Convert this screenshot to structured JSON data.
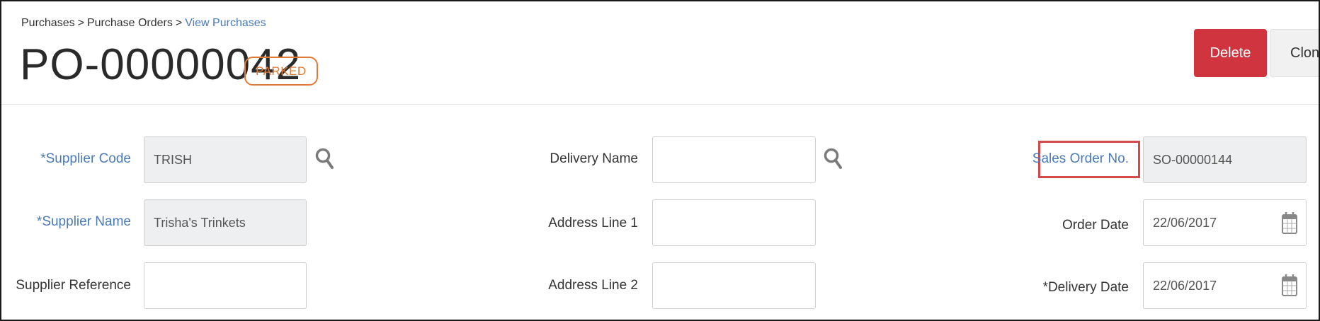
{
  "breadcrumb": {
    "items": [
      "Purchases",
      "Purchase Orders",
      "View Purchases"
    ],
    "separator": ">"
  },
  "header": {
    "title": "PO-00000042",
    "status": "PARKED",
    "status_color": "#e07a36"
  },
  "actions": {
    "delete_label": "Delete",
    "clone_label": "Clone",
    "delete_color": "#d0343e"
  },
  "form": {
    "supplier_code": {
      "label": "*Supplier Code",
      "value": "TRISH"
    },
    "supplier_name": {
      "label": "*Supplier Name",
      "value": "Trisha's Trinkets"
    },
    "supplier_reference": {
      "label": "Supplier Reference",
      "value": ""
    },
    "delivery_name": {
      "label": "Delivery Name",
      "value": ""
    },
    "address_line_1": {
      "label": "Address Line 1",
      "value": ""
    },
    "address_line_2": {
      "label": "Address Line 2",
      "value": ""
    },
    "sales_order_no": {
      "label": "Sales Order No.",
      "value": "SO-00000144"
    },
    "order_date": {
      "label": "Order Date",
      "value": "22/06/2017"
    },
    "delivery_date": {
      "label": "*Delivery Date",
      "value": "22/06/2017"
    }
  },
  "icons": {
    "supplier_lookup": "search-icon",
    "delivery_lookup": "search-icon",
    "order_date_picker": "calendar-icon",
    "delivery_date_picker": "calendar-icon"
  },
  "colors": {
    "link": "#4a7ab8",
    "highlight": "#d34a4a"
  }
}
